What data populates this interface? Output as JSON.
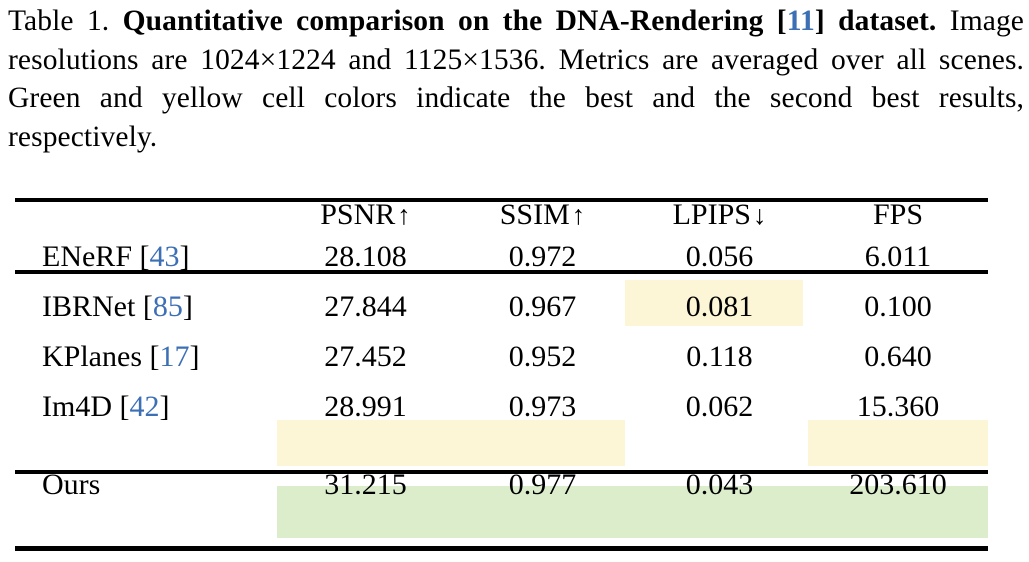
{
  "caption": {
    "label": "Table 1.",
    "bold_title": "Quantitative comparison on the DNA-Rendering",
    "cite_open": "[",
    "cite_number": "11",
    "cite_close": "]",
    "bold_title_2": "dataset.",
    "rest_line1": "Image resolutions are 1024×1224 and 1125×1536.",
    "rest_line2": "Metrics are averaged over all scenes. Green and yellow cell colors",
    "rest_line3": "indicate the best and the second best results, respectively."
  },
  "table": {
    "headers": [
      {
        "text": "",
        "arrow": ""
      },
      {
        "text": "PSNR",
        "arrow": "↑"
      },
      {
        "text": "SSIM",
        "arrow": "↑"
      },
      {
        "text": "LPIPS",
        "arrow": "↓"
      },
      {
        "text": "FPS",
        "arrow": ""
      }
    ],
    "rows": [
      {
        "method": "ENeRF",
        "cite_open": "[",
        "cite": "43",
        "cite_close": "]",
        "psnr": "28.108",
        "ssim": "0.972",
        "lpips": "0.056",
        "fps": "6.011"
      },
      {
        "method": "IBRNet",
        "cite_open": "[",
        "cite": "85",
        "cite_close": "]",
        "psnr": "27.844",
        "ssim": "0.967",
        "lpips": "0.081",
        "fps": "0.100"
      },
      {
        "method": "KPlanes",
        "cite_open": "[",
        "cite": "17",
        "cite_close": "]",
        "psnr": "27.452",
        "ssim": "0.952",
        "lpips": "0.118",
        "fps": "0.640"
      },
      {
        "method": "Im4D",
        "cite_open": "[",
        "cite": "42",
        "cite_close": "]",
        "psnr": "28.991",
        "ssim": "0.973",
        "lpips": "0.062",
        "fps": "15.360"
      }
    ],
    "ours_row": {
      "method": "Ours",
      "cite_open": "",
      "cite": "",
      "cite_close": "",
      "psnr": "31.215",
      "ssim": "0.977",
      "lpips": "0.043",
      "fps": "203.610"
    }
  },
  "colors": {
    "best_green": "#DBEDCB",
    "second_best_yellow": "#FDF6D6",
    "citation_blue": "#3D6FB5",
    "rule_black": "#000000"
  },
  "chart_data": {
    "type": "table",
    "title": "Quantitative comparison on the DNA-Rendering [11] dataset",
    "categories": [
      "ENeRF [43]",
      "IBRNet [85]",
      "KPlanes [17]",
      "Im4D [42]",
      "Ours"
    ],
    "columns": [
      "PSNR ↑",
      "SSIM ↑",
      "LPIPS ↓",
      "FPS"
    ],
    "series": [
      {
        "name": "PSNR ↑",
        "values": [
          28.108,
          27.844,
          27.452,
          28.991,
          31.215
        ]
      },
      {
        "name": "SSIM ↑",
        "values": [
          0.972,
          0.967,
          0.952,
          0.973,
          0.977
        ]
      },
      {
        "name": "LPIPS ↓",
        "values": [
          0.056,
          0.081,
          0.118,
          0.062,
          0.043
        ]
      },
      {
        "name": "FPS",
        "values": [
          6.011,
          0.1,
          0.64,
          15.36,
          203.61
        ]
      }
    ],
    "highlights": {
      "best": [
        {
          "row": "Ours",
          "column": "PSNR ↑"
        },
        {
          "row": "Ours",
          "column": "SSIM ↑"
        },
        {
          "row": "Ours",
          "column": "LPIPS ↓"
        },
        {
          "row": "Ours",
          "column": "FPS"
        }
      ],
      "second_best": [
        {
          "row": "Im4D [42]",
          "column": "PSNR ↑"
        },
        {
          "row": "Im4D [42]",
          "column": "SSIM ↑"
        },
        {
          "row": "ENeRF [43]",
          "column": "LPIPS ↓"
        },
        {
          "row": "Im4D [42]",
          "column": "FPS"
        }
      ]
    }
  }
}
